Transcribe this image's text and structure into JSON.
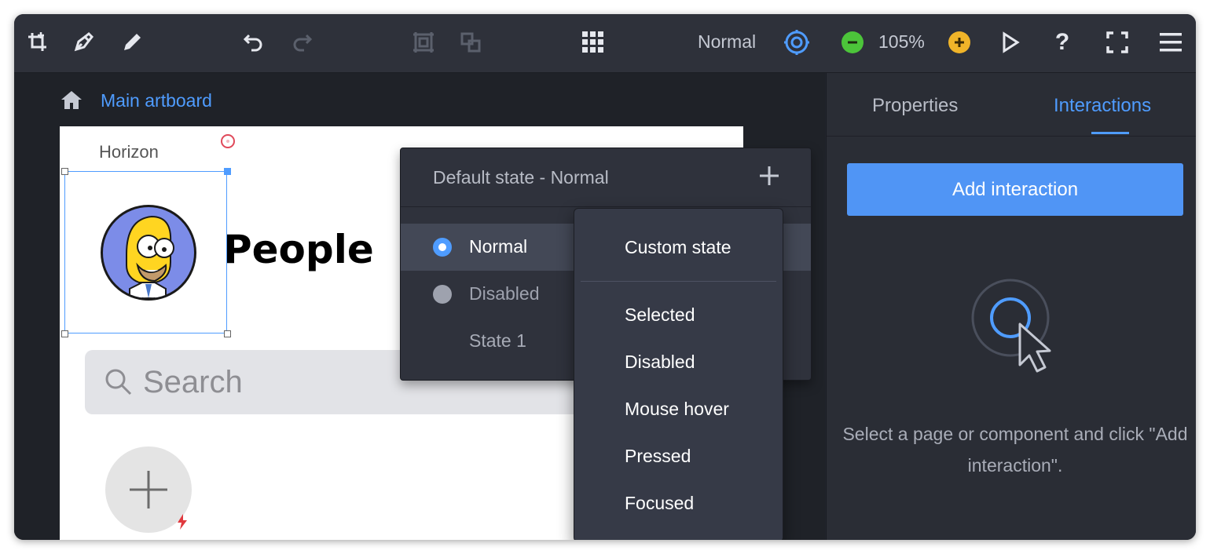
{
  "toolbar": {
    "mode_label": "Normal",
    "zoom_level": "105%",
    "icons": [
      "add-artboard-icon",
      "pen-icon",
      "pencil-icon",
      "undo-icon",
      "redo-icon",
      "group-icon",
      "ungroup-icon",
      "grid-icon",
      "states-icon",
      "zoom-out-icon",
      "zoom-in-icon",
      "play-icon",
      "help-icon",
      "fullscreen-icon",
      "menu-icon"
    ]
  },
  "breadcrumb": {
    "current": "Main artboard"
  },
  "artboard": {
    "status_label": "Horizon",
    "heading": "People",
    "search_placeholder": "Search"
  },
  "states_panel": {
    "title": "Default state - Normal",
    "states": [
      {
        "label": "Normal",
        "selected": true
      },
      {
        "label": "Disabled",
        "selected": false
      },
      {
        "label": "State 1",
        "selected": false
      }
    ]
  },
  "state_menu": {
    "items": [
      "Custom state",
      "Selected",
      "Disabled",
      "Mouse hover",
      "Pressed",
      "Focused"
    ]
  },
  "right_panel": {
    "tabs": [
      "Properties",
      "Interactions"
    ],
    "active_tab": "Interactions",
    "add_button": "Add interaction",
    "empty_message": "Select a page or component and click \"Add interaction\"."
  },
  "colors": {
    "accent": "#4f9cff",
    "button": "#5095f5",
    "zoom_out": "#4cc43a",
    "zoom_in": "#f0b429"
  }
}
